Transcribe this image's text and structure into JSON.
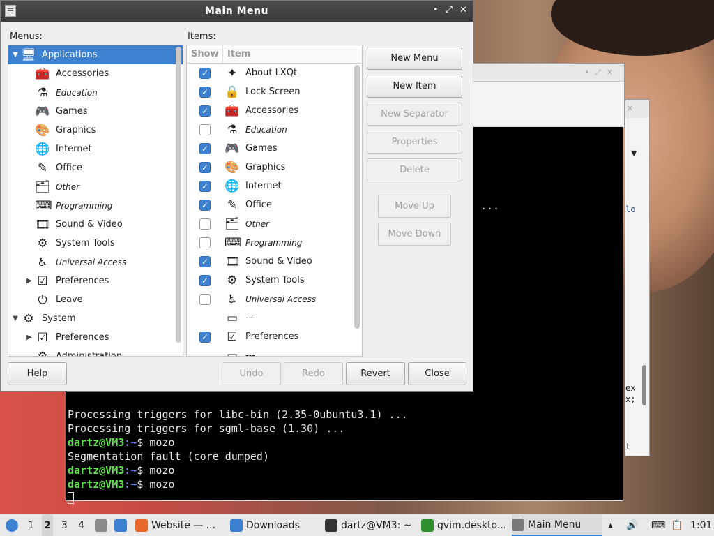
{
  "window": {
    "title": "Main Menu",
    "controls": [
      "•",
      "⤢",
      "✕"
    ]
  },
  "menus_label": "Menus:",
  "items_label": "Items:",
  "tree": [
    {
      "label": "Applications",
      "icon": "applications-icon",
      "glyph": "🖥",
      "expander": "▼",
      "level": 0,
      "selected": true,
      "italic": false
    },
    {
      "label": "Accessories",
      "icon": "accessories-icon",
      "glyph": "🧰",
      "expander": "",
      "level": 1,
      "selected": false,
      "italic": false
    },
    {
      "label": "Education",
      "icon": "education-icon",
      "glyph": "⚗",
      "expander": "",
      "level": 1,
      "selected": false,
      "italic": true
    },
    {
      "label": "Games",
      "icon": "games-icon",
      "glyph": "🎮",
      "expander": "",
      "level": 1,
      "selected": false,
      "italic": false
    },
    {
      "label": "Graphics",
      "icon": "graphics-icon",
      "glyph": "🎨",
      "expander": "",
      "level": 1,
      "selected": false,
      "italic": false
    },
    {
      "label": "Internet",
      "icon": "internet-icon",
      "glyph": "🌐",
      "expander": "",
      "level": 1,
      "selected": false,
      "italic": false
    },
    {
      "label": "Office",
      "icon": "office-icon",
      "glyph": "✎",
      "expander": "",
      "level": 1,
      "selected": false,
      "italic": false
    },
    {
      "label": "Other",
      "icon": "other-icon",
      "glyph": "🗂",
      "expander": "",
      "level": 1,
      "selected": false,
      "italic": true
    },
    {
      "label": "Programming",
      "icon": "programming-icon",
      "glyph": "⌨",
      "expander": "",
      "level": 1,
      "selected": false,
      "italic": true
    },
    {
      "label": "Sound & Video",
      "icon": "sound-video-icon",
      "glyph": "🎞",
      "expander": "",
      "level": 1,
      "selected": false,
      "italic": false
    },
    {
      "label": "System Tools",
      "icon": "system-tools-icon",
      "glyph": "⚙",
      "expander": "",
      "level": 1,
      "selected": false,
      "italic": false
    },
    {
      "label": "Universal Access",
      "icon": "universal-access-icon",
      "glyph": "♿",
      "expander": "",
      "level": 1,
      "selected": false,
      "italic": true
    },
    {
      "label": "Preferences",
      "icon": "preferences-icon",
      "glyph": "☑",
      "expander": "▶",
      "level": 1,
      "selected": false,
      "italic": false
    },
    {
      "label": "Leave",
      "icon": "leave-icon",
      "glyph": "⏻",
      "expander": "",
      "level": 1,
      "selected": false,
      "italic": false
    },
    {
      "label": "System",
      "icon": "system-icon",
      "glyph": "⚙",
      "expander": "▼",
      "level": 0,
      "selected": false,
      "italic": false
    },
    {
      "label": "Preferences",
      "icon": "preferences-icon",
      "glyph": "☑",
      "expander": "▶",
      "level": 1,
      "selected": false,
      "italic": false
    },
    {
      "label": "Administration",
      "icon": "administration-icon",
      "glyph": "⚙",
      "expander": "",
      "level": 1,
      "selected": false,
      "italic": false
    }
  ],
  "items_header": {
    "show": "Show",
    "item": "Item"
  },
  "items": [
    {
      "label": "About LXQt",
      "icon": "about-icon",
      "glyph": "✦",
      "checked": true,
      "italic": false,
      "has_check": true
    },
    {
      "label": "Lock Screen",
      "icon": "lock-icon",
      "glyph": "🔒",
      "checked": true,
      "italic": false,
      "has_check": true
    },
    {
      "label": "Accessories",
      "icon": "accessories-icon",
      "glyph": "🧰",
      "checked": true,
      "italic": false,
      "has_check": true
    },
    {
      "label": "Education",
      "icon": "education-icon",
      "glyph": "⚗",
      "checked": false,
      "italic": true,
      "has_check": true
    },
    {
      "label": "Games",
      "icon": "games-icon",
      "glyph": "🎮",
      "checked": true,
      "italic": false,
      "has_check": true
    },
    {
      "label": "Graphics",
      "icon": "graphics-icon",
      "glyph": "🎨",
      "checked": true,
      "italic": false,
      "has_check": true
    },
    {
      "label": "Internet",
      "icon": "internet-icon",
      "glyph": "🌐",
      "checked": true,
      "italic": false,
      "has_check": true
    },
    {
      "label": "Office",
      "icon": "office-icon",
      "glyph": "✎",
      "checked": true,
      "italic": false,
      "has_check": true
    },
    {
      "label": "Other",
      "icon": "other-icon",
      "glyph": "🗂",
      "checked": false,
      "italic": true,
      "has_check": true
    },
    {
      "label": "Programming",
      "icon": "programming-icon",
      "glyph": "⌨",
      "checked": false,
      "italic": true,
      "has_check": true
    },
    {
      "label": "Sound & Video",
      "icon": "sound-video-icon",
      "glyph": "🎞",
      "checked": true,
      "italic": false,
      "has_check": true
    },
    {
      "label": "System Tools",
      "icon": "system-tools-icon",
      "glyph": "⚙",
      "checked": true,
      "italic": false,
      "has_check": true
    },
    {
      "label": "Universal Access",
      "icon": "universal-access-icon",
      "glyph": "♿",
      "checked": false,
      "italic": true,
      "has_check": true
    },
    {
      "label": "---",
      "icon": "separator-icon",
      "glyph": "▭",
      "checked": false,
      "italic": false,
      "has_check": false
    },
    {
      "label": "Preferences",
      "icon": "preferences-icon",
      "glyph": "☑",
      "checked": true,
      "italic": false,
      "has_check": true
    },
    {
      "label": "---",
      "icon": "separator-icon",
      "glyph": "▭",
      "checked": false,
      "italic": false,
      "has_check": false
    }
  ],
  "side_buttons": {
    "new_menu": "New Menu",
    "new_item": "New Item",
    "new_separator": "New Separator",
    "properties": "Properties",
    "delete": "Delete",
    "move_up": "Move Up",
    "move_down": "Move Down"
  },
  "bottom_buttons": {
    "help": "Help",
    "undo": "Undo",
    "redo": "Redo",
    "revert": "Revert",
    "close": "Close"
  },
  "terminal": {
    "dots": "...",
    "line1": "Processing triggers for libc-bin (2.35-0ubuntu3.1) ...",
    "line2": "Processing triggers for sgml-base (1.30) ...",
    "user": "dartz@VM3",
    "path": ":~",
    "prompt": "$ ",
    "cmd": "mozo",
    "segfault": "Segmentation fault (core dumped)"
  },
  "bg_editor": {
    "t1": "lo",
    "t2a": "ex",
    "t2b": "x;",
    "t3": "t"
  },
  "taskbar": {
    "workspaces": [
      "1",
      "2",
      "3",
      "4"
    ],
    "tasks": [
      {
        "label": "Website — ...",
        "icon": "firefox-icon",
        "color": "#e8662a"
      },
      {
        "label": "Downloads",
        "icon": "folder-icon",
        "color": "#3c7fd0"
      },
      {
        "label": "dartz@VM3: ~",
        "icon": "terminal-icon",
        "color": "#333333"
      },
      {
        "label": "gvim.deskto...",
        "icon": "vim-icon",
        "color": "#2f8f2f"
      },
      {
        "label": "Main Menu",
        "icon": "menu-editor-icon",
        "color": "#7a7a7a"
      }
    ],
    "clock": "1:01"
  },
  "colors": {
    "selection": "#3d82d0",
    "prompt_green": "#5de04a",
    "prompt_blue": "#6f8cff"
  }
}
